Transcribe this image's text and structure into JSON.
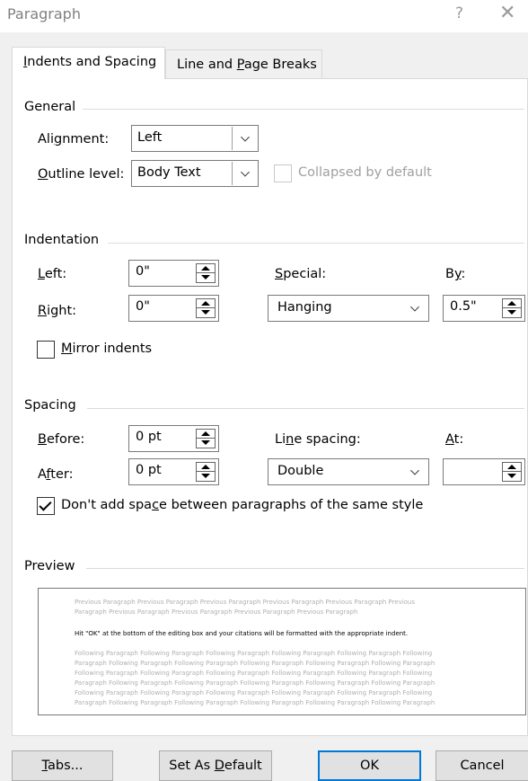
{
  "window": {
    "title": "Paragraph",
    "help_glyph": "?",
    "close_glyph": "✕"
  },
  "tabs": [
    {
      "pre": "",
      "key": "I",
      "post": "ndents and Spacing"
    },
    {
      "pre": "Line and ",
      "key": "P",
      "post": "age Breaks"
    }
  ],
  "general": {
    "title": "General",
    "alignment_label": {
      "pre": "Ali",
      "key": "g",
      "post": "nment:"
    },
    "alignment_value": "Left",
    "outline_label": {
      "pre": "",
      "key": "O",
      "post": "utline level:"
    },
    "outline_value": "Body Text",
    "collapsed_label": "Collapsed by default",
    "collapsed_checked": false
  },
  "indentation": {
    "title": "Indentation",
    "left_label": {
      "pre": "",
      "key": "L",
      "post": "eft:"
    },
    "left_value": "0\"",
    "right_label": {
      "pre": "",
      "key": "R",
      "post": "ight:"
    },
    "right_value": "0\"",
    "special_label": {
      "pre": "",
      "key": "S",
      "post": "pecial:"
    },
    "special_value": "Hanging",
    "by_label": {
      "pre": "B",
      "key": "y",
      "post": ":"
    },
    "by_value": "0.5\"",
    "mirror_label": {
      "pre": "",
      "key": "M",
      "post": "irror indents"
    },
    "mirror_checked": false
  },
  "spacing": {
    "title": "Spacing",
    "before_label": {
      "pre": "",
      "key": "B",
      "post": "efore:"
    },
    "before_value": "0 pt",
    "after_label": {
      "pre": "A",
      "key": "f",
      "post": "ter:"
    },
    "after_value": "0 pt",
    "line_label": {
      "pre": "Li",
      "key": "n",
      "post": "e spacing:"
    },
    "line_value": "Double",
    "at_label": {
      "pre": "",
      "key": "A",
      "post": "t:"
    },
    "at_value": "",
    "dont_add_label": {
      "pre": "Don't add spa",
      "key": "c",
      "post": "e between paragraphs of the same style"
    },
    "dont_add_checked": true
  },
  "preview": {
    "title": "Preview",
    "previous_lines": [
      "Previous Paragraph Previous Paragraph Previous Paragraph Previous Paragraph Previous Paragraph Previous",
      "Paragraph Previous Paragraph Previous Paragraph Previous Paragraph Previous Paragraph"
    ],
    "main_line": "Hit \"OK\" at the bottom of the editing box and your citations will be formatted with the appropriate indent.",
    "following_lines": [
      "Following Paragraph Following Paragraph Following Paragraph Following Paragraph Following Paragraph Following",
      "Paragraph Following Paragraph Following Paragraph Following Paragraph Following Paragraph Following Paragraph",
      "Following Paragraph Following Paragraph Following Paragraph Following Paragraph Following Paragraph Following",
      "Paragraph Following Paragraph Following Paragraph Following Paragraph Following Paragraph Following Paragraph",
      "Following Paragraph Following Paragraph Following Paragraph Following Paragraph Following Paragraph Following",
      "Paragraph Following Paragraph Following Paragraph Following Paragraph Following Paragraph Following Paragraph"
    ]
  },
  "buttons": {
    "tabs": {
      "pre": "",
      "key": "T",
      "post": "abs..."
    },
    "set_default": {
      "pre": "Set As ",
      "key": "D",
      "post": "efault"
    },
    "ok": "OK",
    "cancel": "Cancel"
  },
  "colors": {
    "accent": "#0078d7",
    "panel": "#ffffff",
    "chrome": "#f0f0f0"
  }
}
